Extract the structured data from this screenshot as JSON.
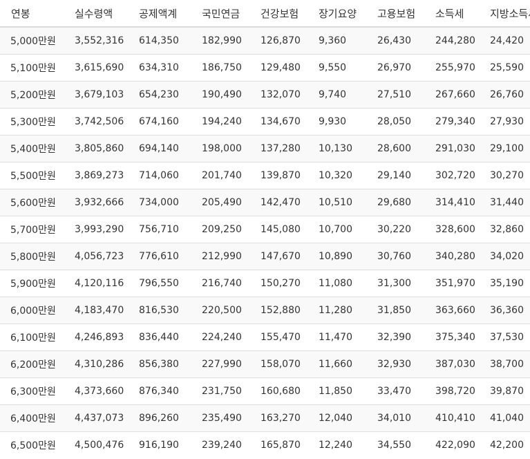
{
  "table": {
    "headers": [
      "연봉",
      "실수령액",
      "공제액계",
      "국민연금",
      "건강보험",
      "장기요양",
      "고용보험",
      "소득세",
      "지방소득세"
    ],
    "rows": [
      [
        "5,000만원",
        "3,552,316",
        "614,350",
        "182,990",
        "126,870",
        "9,360",
        "26,430",
        "244,280",
        "24,420"
      ],
      [
        "5,100만원",
        "3,615,690",
        "634,310",
        "186,750",
        "129,480",
        "9,550",
        "26,970",
        "255,970",
        "25,590"
      ],
      [
        "5,200만원",
        "3,679,103",
        "654,230",
        "190,490",
        "132,070",
        "9,740",
        "27,510",
        "267,660",
        "26,760"
      ],
      [
        "5,300만원",
        "3,742,506",
        "674,160",
        "194,240",
        "134,670",
        "9,930",
        "28,050",
        "279,340",
        "27,930"
      ],
      [
        "5,400만원",
        "3,805,860",
        "694,140",
        "198,000",
        "137,280",
        "10,130",
        "28,600",
        "291,030",
        "29,100"
      ],
      [
        "5,500만원",
        "3,869,273",
        "714,060",
        "201,740",
        "139,870",
        "10,320",
        "29,140",
        "302,720",
        "30,270"
      ],
      [
        "5,600만원",
        "3,932,666",
        "734,000",
        "205,490",
        "142,470",
        "10,510",
        "29,680",
        "314,410",
        "31,440"
      ],
      [
        "5,700만원",
        "3,993,290",
        "756,710",
        "209,250",
        "145,080",
        "10,700",
        "30,220",
        "328,600",
        "32,860"
      ],
      [
        "5,800만원",
        "4,056,723",
        "776,610",
        "212,990",
        "147,670",
        "10,890",
        "30,760",
        "340,280",
        "34,020"
      ],
      [
        "5,900만원",
        "4,120,116",
        "796,550",
        "216,740",
        "150,270",
        "11,080",
        "31,300",
        "351,970",
        "35,190"
      ],
      [
        "6,000만원",
        "4,183,470",
        "816,530",
        "220,500",
        "152,880",
        "11,280",
        "31,850",
        "363,660",
        "36,360"
      ],
      [
        "6,100만원",
        "4,246,893",
        "836,440",
        "224,240",
        "155,470",
        "11,470",
        "32,390",
        "375,340",
        "37,530"
      ],
      [
        "6,200만원",
        "4,310,286",
        "856,380",
        "227,990",
        "158,070",
        "11,660",
        "32,930",
        "387,030",
        "38,700"
      ],
      [
        "6,300만원",
        "4,373,660",
        "876,340",
        "231,750",
        "160,680",
        "11,850",
        "33,470",
        "398,720",
        "39,870"
      ],
      [
        "6,400만원",
        "4,437,073",
        "896,260",
        "235,490",
        "163,270",
        "12,040",
        "34,010",
        "410,410",
        "41,040"
      ],
      [
        "6,500만원",
        "4,500,476",
        "916,190",
        "239,240",
        "165,870",
        "12,240",
        "34,550",
        "422,090",
        "42,200"
      ]
    ]
  },
  "colors": {
    "text": "#333333",
    "header_border": "#d9d9d9",
    "row_border": "#dddddd",
    "row_stripe": "#f9f9f9",
    "background": "#ffffff"
  }
}
